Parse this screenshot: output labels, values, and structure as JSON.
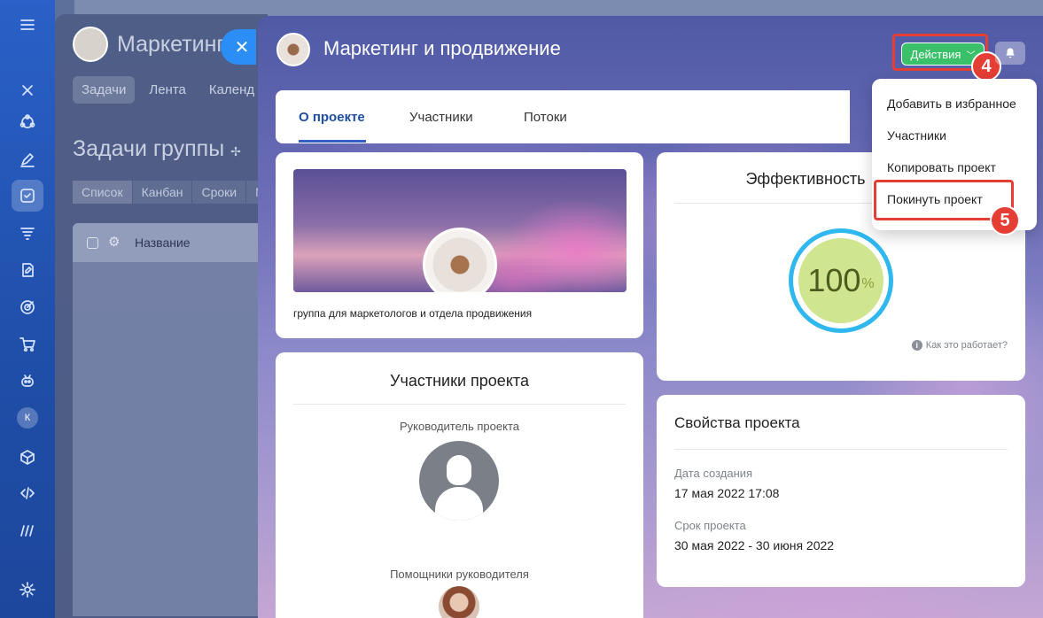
{
  "background": {
    "group_title": "Маркетинг",
    "tabs": [
      {
        "label": "Задачи",
        "active": true
      },
      {
        "label": "Лента",
        "active": false
      },
      {
        "label": "Календ",
        "active": false
      }
    ],
    "heading": "Задачи группы",
    "views": [
      {
        "label": "Список",
        "active": true
      },
      {
        "label": "Канбан",
        "active": false
      },
      {
        "label": "Сроки",
        "active": false
      },
      {
        "label": "М",
        "active": false
      }
    ],
    "grid_header": "Название"
  },
  "slider": {
    "title": "Маркетинг и продвижение",
    "actions_label": "Действия",
    "tabs": [
      {
        "label": "О проекте",
        "active": true
      },
      {
        "label": "Участники",
        "active": false
      },
      {
        "label": "Потоки",
        "active": false
      }
    ],
    "about": {
      "description": "группа для маркетологов и отдела продвижения"
    },
    "efficiency": {
      "title": "Эффективность",
      "value": 100,
      "value_text": "100",
      "unit": "%",
      "help_link": "Как это работает?"
    },
    "members": {
      "title": "Участники проекта",
      "owner_label": "Руководитель проекта",
      "moderators_label": "Помощники руководителя"
    },
    "properties": {
      "title": "Свойства проекта",
      "created_label": "Дата создания",
      "created_value": "17 мая 2022 17:08",
      "term_label": "Срок проекта",
      "term_value": "30 мая 2022 - 30 июня 2022"
    }
  },
  "actions_menu": {
    "items": [
      "Добавить в избранное",
      "Участники",
      "Копировать проект",
      "Покинуть проект"
    ]
  },
  "step_badges": [
    "4",
    "5"
  ],
  "avatar_initial": "К",
  "colors": {
    "accent_green": "#3bc06a",
    "highlight_red": "#e53e35",
    "tab_active_blue": "#2f5fc7",
    "gauge_ring": "#2fb7f0",
    "gauge_fill": "#cfe590"
  }
}
